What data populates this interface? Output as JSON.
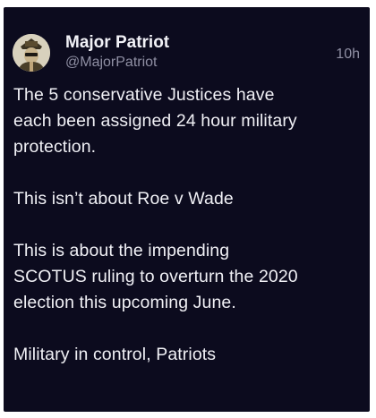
{
  "post": {
    "author": {
      "display_name": "Major Patriot",
      "handle": "@MajorPatriot",
      "avatar_icon": "patriot-avatar-icon"
    },
    "timestamp": "10h",
    "paragraphs": [
      "The 5 conservative Justices have\neach been assigned 24 hour military\nprotection.",
      "This isn’t about Roe v Wade",
      "This is about the impending\nSCOTUS ruling to overturn the 2020\nelection this upcoming June.",
      "Military in control, Patriots"
    ]
  },
  "colors": {
    "card_background": "#0c0b1e",
    "primary_text": "#f0f0f5",
    "secondary_text": "#8f8fa3"
  }
}
